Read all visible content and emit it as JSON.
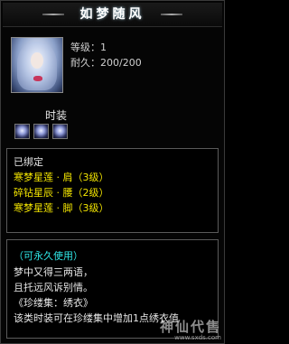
{
  "item": {
    "name": "如梦随风",
    "level_label": "等级：1",
    "durability_label": "耐久：200/200",
    "gem_section_label": "时装"
  },
  "set_panel": {
    "bound": "已绑定",
    "parts": [
      "寒梦星莲 · 肩（3级）",
      "碎钻星辰 · 腰（2级）",
      "寒梦星莲 · 脚（3级）"
    ]
  },
  "desc_panel": {
    "usage": "（可永久使用）",
    "lines": [
      "梦中又得三两语，",
      "且托远风诉别情。",
      "《珍缕集：绣衣》",
      "该类时装可在珍缕集中增加1点绣衣值"
    ]
  },
  "watermark": {
    "text": "神仙代售",
    "sub": "www.sxds.com"
  },
  "colors": {
    "name": "#ffffff",
    "set_part": "#f2e400",
    "usage": "#2fe7e7"
  }
}
